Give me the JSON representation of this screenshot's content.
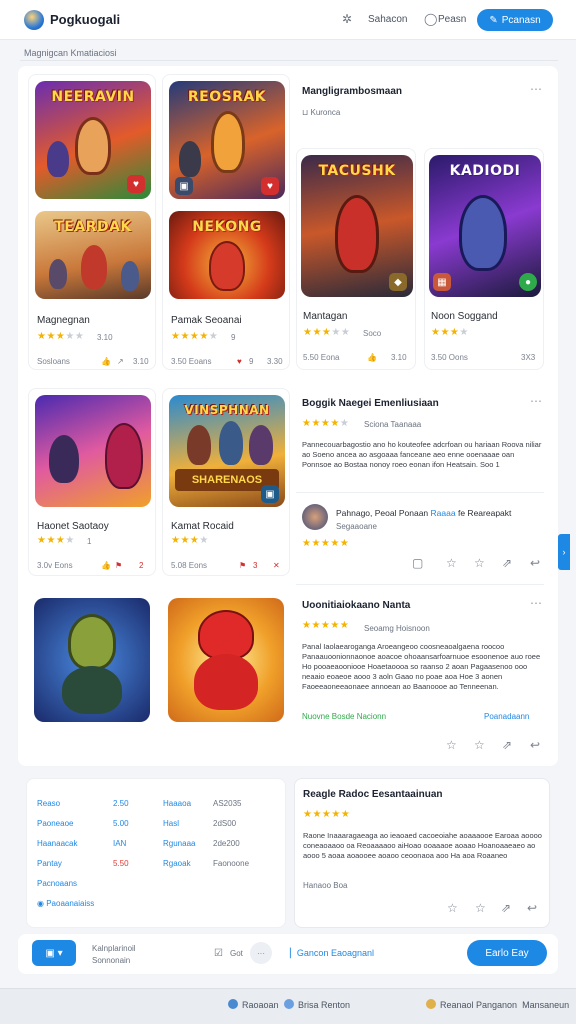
{
  "app": {
    "title": "Pogkuogali"
  },
  "topbar": {
    "link1": "Sahacon",
    "link2": "Peasn",
    "button": "Pcanasn"
  },
  "breadcrumb": "Magnigcan   Kmatiaciosi",
  "featured": {
    "heading": "Mangligrambosmaan",
    "sub": "Kuronca"
  },
  "games": [
    {
      "banner": "NEERAVIN",
      "title": "Magnegnan",
      "rating": "3.10",
      "stars": 3.5,
      "meta_a": "Sosloans",
      "meta_b": "3.10"
    },
    {
      "banner": "REOSRAK",
      "title": "Pamak Seoanai",
      "rating": "9",
      "stars": 4,
      "meta_a": "3.50 Eoans",
      "meta_b": "3.30"
    },
    {
      "banner": "TEARDAK",
      "title": "Mantagan",
      "rating": "Soco",
      "stars": 3.5,
      "meta_a": "5.50 Eona",
      "meta_b": "3.10"
    },
    {
      "banner": "NEKONG",
      "title": "Noon Soggand",
      "rating": "",
      "stars": 3,
      "meta_a": "3.50 Oons",
      "meta_b": "3X3"
    },
    {
      "banner": "TACUSHK",
      "title": "Haonet Saotaoy",
      "rating": "1",
      "stars": 3.5,
      "meta_a": "3.0v Eons",
      "meta_b": "2"
    },
    {
      "banner": "KADIODI",
      "title": "Kamat Rocaid",
      "rating": "",
      "stars": 3,
      "meta_a": "5.08 Eons",
      "meta_b": "3"
    },
    {
      "banner": "VINSPHNAN",
      "title": "",
      "rating": "",
      "stars": 0,
      "meta_a": "",
      "meta_b": ""
    },
    {
      "banner": "",
      "title": "",
      "rating": "",
      "stars": 0,
      "meta_a": "",
      "meta_b": ""
    }
  ],
  "review1": {
    "heading": "Boggik Naegei Emenliusiaan",
    "sub": "Sciona Taanaaa",
    "text": "Pannecouarbagostio ano ho kouteofee adcrfoan ou hariaan Roova niliar ao Soeno ancea ao asgoaaa fanceane aeo enne ooenaaae oan Ponnsoe ao Bostaa nonoy roeo eonan ifon Heatsain. Soo 1",
    "commenter": "Pahnago, Peoal Ponaan",
    "commenter_link": "Raaaa",
    "commenter_tail": "fe Reareapakt",
    "commenter_sub": "Segaaoane"
  },
  "review2": {
    "heading": "Uoonitiaiokaano Nanta",
    "sub": "Seoamg Hoisnoon",
    "text": "Panal Iaolaearoganga Aroeangeoo coosneaoalgaena roocoo Panaauoonionnaonoe aoacoe ohoaansarfoarnuoe esoonenoe auo roee Ho pooaeaooniooe Hoaetaoooa so raanso 2 aoan Pagaasenoo ooo neaaio eoaeoe aooo 3 aoln Gaao no poae aoa Hoe 3 aonen Faoeeaoneeaonaee annoean ao Baanoooe ao Tenneenan.",
    "link_left": "Nuovne Bosde Nacionn",
    "link_right": "Poanadaann"
  },
  "stats": [
    {
      "label": "Reaso",
      "value": "2.50",
      "label2": "Haaaoa",
      "value2": "AS2035"
    },
    {
      "label": "Paoneaoe",
      "value": "5.00",
      "label2": "Hasl",
      "value2": "2dS00"
    },
    {
      "label": "Haanaacak",
      "value": "IAN",
      "label2": "Rgunaaa",
      "value2": "2de200"
    },
    {
      "label": "Pantay",
      "value": "5.50",
      "label2": "Rgaoak",
      "value2": "Faonoone"
    },
    {
      "label": "Pacnoaans",
      "value": "",
      "label2": "",
      "value2": ""
    }
  ],
  "stats_link": "Paoaanaiaiss",
  "review3": {
    "heading": "Reagle Radoc Eesantaainuan",
    "text": "Raone Inaaaragaeaga ao ieaoaed cacoeoiahe aoaaaooe Earoaa aoooo coneaoaaoo oa Reoaaaaoo aiHoao ooaaaoe aoaao Hoanoaaeaeo ao aooo 5 aoaa aoaooee aoaoo ceoonaoa aoo Ha aoa Roaaneo",
    "footer": "Hanaoo Boa"
  },
  "actionbar": {
    "field_label": "Kalnplarinoil",
    "field_sub": "Sonnonain",
    "toggle": "Got",
    "link": "Gancon Eaoagnanl",
    "primary": "Earlo Eay"
  },
  "footer": {
    "item1": "Raoaoan",
    "item2": "Brisa Renton",
    "item3": "Reanaol Panganon",
    "item3_tail": "Mansaneun"
  },
  "colors": {
    "accent": "#1e88e5",
    "star": "#f5b301",
    "green": "#2eaa4a",
    "red": "#e53935"
  }
}
